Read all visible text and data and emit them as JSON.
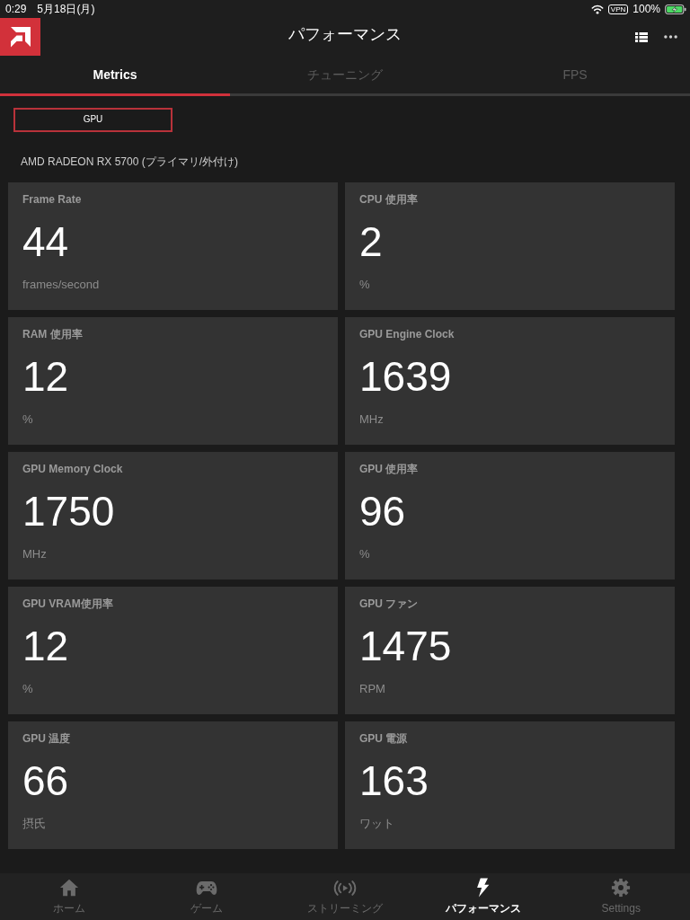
{
  "status_bar": {
    "time": "0:29",
    "date": "5月18日(月)",
    "vpn": "VPN",
    "battery": "100%"
  },
  "header": {
    "title": "パフォーマンス"
  },
  "tabs": [
    {
      "label": "Metrics",
      "selected": true
    },
    {
      "label": "チューニング",
      "selected": false
    },
    {
      "label": "FPS",
      "selected": false
    }
  ],
  "gpu_button": {
    "label": "GPU"
  },
  "device_name": "AMD RADEON RX 5700 (プライマリ/外付け)",
  "metrics": [
    {
      "title": "Frame Rate",
      "value": "44",
      "unit": "frames/second"
    },
    {
      "title": "CPU 使用率",
      "value": "2",
      "unit": "%"
    },
    {
      "title": "RAM 使用率",
      "value": "12",
      "unit": "%"
    },
    {
      "title": "GPU Engine Clock",
      "value": "1639",
      "unit": "MHz"
    },
    {
      "title": "GPU Memory Clock",
      "value": "1750",
      "unit": "MHz"
    },
    {
      "title": "GPU 使用率",
      "value": "96",
      "unit": "%"
    },
    {
      "title": "GPU VRAM使用率",
      "value": "12",
      "unit": "%"
    },
    {
      "title": "GPU ファン",
      "value": "1475",
      "unit": "RPM"
    },
    {
      "title": "GPU 温度",
      "value": "66",
      "unit": "摂氏"
    },
    {
      "title": "GPU 電源",
      "value": "163",
      "unit": "ワット"
    }
  ],
  "bottom_nav": [
    {
      "label": "ホーム",
      "selected": false
    },
    {
      "label": "ゲーム",
      "selected": false
    },
    {
      "label": "ストリーミング",
      "selected": false
    },
    {
      "label": "パフォーマンス",
      "selected": true
    },
    {
      "label": "Settings",
      "selected": false
    }
  ]
}
